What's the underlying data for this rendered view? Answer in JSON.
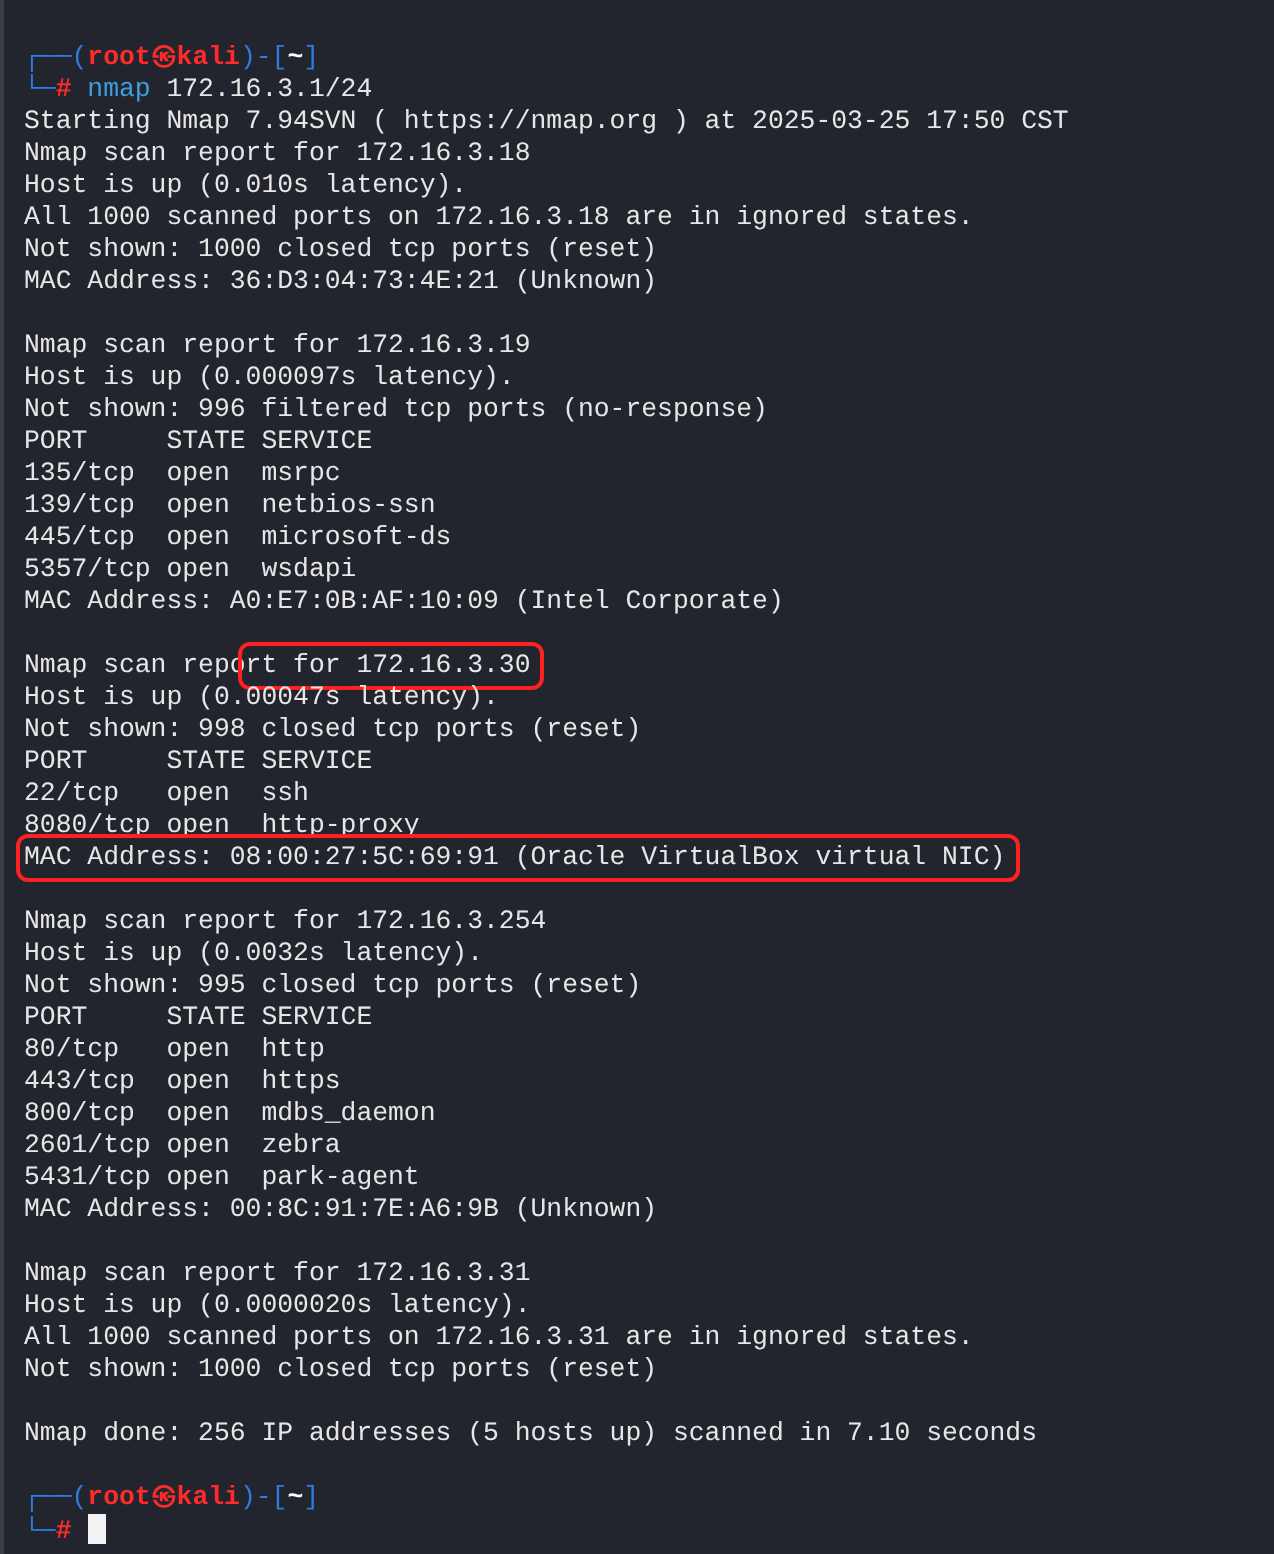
{
  "terminal": {
    "lines": [
      {
        "kind": "prompt",
        "segments": [
          {
            "text": "┌──(",
            "kind": "frame"
          },
          {
            "text": "root㉿kali",
            "kind": "user"
          },
          {
            "text": ")-[",
            "kind": "frame"
          },
          {
            "text": "~",
            "kind": "path"
          },
          {
            "text": "]",
            "kind": "frame"
          }
        ]
      },
      {
        "kind": "command",
        "segments": [
          {
            "text": "└─",
            "kind": "frame"
          },
          {
            "text": "#",
            "kind": "hash"
          },
          {
            "text": "nmap",
            "kind": "program"
          },
          {
            "text": " 172.16.3.1/24",
            "kind": "plain"
          }
        ]
      },
      {
        "kind": "output",
        "segments": [
          {
            "text": "Starting Nmap 7.94SVN ( https://nmap.org ) at 2025-03-25 17:50 CST",
            "highlighted": false
          }
        ]
      },
      {
        "kind": "output",
        "segments": [
          {
            "text": "Nmap scan report for 172.16.3.18",
            "highlighted": false
          }
        ]
      },
      {
        "kind": "output",
        "segments": [
          {
            "text": "Host is up (0.010s latency).",
            "highlighted": false
          }
        ]
      },
      {
        "kind": "output",
        "segments": [
          {
            "text": "All 1000 scanned ports on 172.16.3.18 are in ignored states.",
            "highlighted": false
          }
        ]
      },
      {
        "kind": "output",
        "segments": [
          {
            "text": "Not shown: 1000 closed tcp ports (reset)",
            "highlighted": false
          }
        ]
      },
      {
        "kind": "output",
        "segments": [
          {
            "text": "MAC Address: 36:D3:04:73:4E:21 (Unknown)",
            "highlighted": false
          }
        ]
      },
      {
        "kind": "blank"
      },
      {
        "kind": "output",
        "segments": [
          {
            "text": "Nmap scan report for 172.16.3.19",
            "highlighted": false
          }
        ]
      },
      {
        "kind": "output",
        "segments": [
          {
            "text": "Host is up (0.000097s latency).",
            "highlighted": false
          }
        ]
      },
      {
        "kind": "output",
        "segments": [
          {
            "text": "Not shown: 996 filtered tcp ports (no-response)",
            "highlighted": false
          }
        ]
      },
      {
        "kind": "output",
        "segments": [
          {
            "text": "PORT     STATE SERVICE",
            "highlighted": false
          }
        ]
      },
      {
        "kind": "output",
        "segments": [
          {
            "text": "135/tcp  open  msrpc",
            "highlighted": false
          }
        ]
      },
      {
        "kind": "output",
        "segments": [
          {
            "text": "139/tcp  open  netbios-ssn",
            "highlighted": false
          }
        ]
      },
      {
        "kind": "output",
        "segments": [
          {
            "text": "445/tcp  open  microsoft-ds",
            "highlighted": false
          }
        ]
      },
      {
        "kind": "output",
        "segments": [
          {
            "text": "5357/tcp open  wsdapi",
            "highlighted": false
          }
        ]
      },
      {
        "kind": "output",
        "segments": [
          {
            "text": "MAC Address: A0:E7:0B:AF:10:09 (Intel Corporate)",
            "highlighted": false
          }
        ]
      },
      {
        "kind": "blank"
      },
      {
        "kind": "output",
        "segments": [
          {
            "text": "Nmap scan repo",
            "highlighted": false
          },
          {
            "text": "rt for 172.16.3.30",
            "highlighted": true
          }
        ]
      },
      {
        "kind": "output",
        "segments": [
          {
            "text": "Host is up (0.00047s latency).",
            "highlighted": false
          }
        ]
      },
      {
        "kind": "output",
        "segments": [
          {
            "text": "Not shown: 998 closed tcp ports (reset)",
            "highlighted": false
          }
        ]
      },
      {
        "kind": "output",
        "segments": [
          {
            "text": "PORT     STATE SERVICE",
            "highlighted": false
          }
        ]
      },
      {
        "kind": "output",
        "segments": [
          {
            "text": "22/tcp   open  ssh",
            "highlighted": false
          }
        ]
      },
      {
        "kind": "output",
        "segments": [
          {
            "text": "8080/tcp open  http-proxy",
            "highlighted": false
          }
        ]
      },
      {
        "kind": "output",
        "segments": [
          {
            "text": "MAC Address: 08:00:27:5C:69:91 (Oracle VirtualBox virtual NIC)",
            "highlighted": true
          }
        ]
      },
      {
        "kind": "blank"
      },
      {
        "kind": "output",
        "segments": [
          {
            "text": "Nmap scan report for 172.16.3.254",
            "highlighted": false
          }
        ]
      },
      {
        "kind": "output",
        "segments": [
          {
            "text": "Host is up (0.0032s latency).",
            "highlighted": false
          }
        ]
      },
      {
        "kind": "output",
        "segments": [
          {
            "text": "Not shown: 995 closed tcp ports (reset)",
            "highlighted": false
          }
        ]
      },
      {
        "kind": "output",
        "segments": [
          {
            "text": "PORT     STATE SERVICE",
            "highlighted": false
          }
        ]
      },
      {
        "kind": "output",
        "segments": [
          {
            "text": "80/tcp   open  http",
            "highlighted": false
          }
        ]
      },
      {
        "kind": "output",
        "segments": [
          {
            "text": "443/tcp  open  https",
            "highlighted": false
          }
        ]
      },
      {
        "kind": "output",
        "segments": [
          {
            "text": "800/tcp  open  mdbs_daemon",
            "highlighted": false
          }
        ]
      },
      {
        "kind": "output",
        "segments": [
          {
            "text": "2601/tcp open  zebra",
            "highlighted": false
          }
        ]
      },
      {
        "kind": "output",
        "segments": [
          {
            "text": "5431/tcp open  park-agent",
            "highlighted": false
          }
        ]
      },
      {
        "kind": "output",
        "segments": [
          {
            "text": "MAC Address: 00:8C:91:7E:A6:9B (Unknown)",
            "highlighted": false
          }
        ]
      },
      {
        "kind": "blank"
      },
      {
        "kind": "output",
        "segments": [
          {
            "text": "Nmap scan report for 172.16.3.31",
            "highlighted": false
          }
        ]
      },
      {
        "kind": "output",
        "segments": [
          {
            "text": "Host is up (0.0000020s latency).",
            "highlighted": false
          }
        ]
      },
      {
        "kind": "output",
        "segments": [
          {
            "text": "All 1000 scanned ports on 172.16.3.31 are in ignored states.",
            "highlighted": false
          }
        ]
      },
      {
        "kind": "output",
        "segments": [
          {
            "text": "Not shown: 1000 closed tcp ports (reset)",
            "highlighted": false
          }
        ]
      },
      {
        "kind": "blank"
      },
      {
        "kind": "output",
        "segments": [
          {
            "text": "Nmap done: 256 IP addresses (5 hosts up) scanned in 7.10 seconds",
            "highlighted": false
          }
        ]
      },
      {
        "kind": "blank"
      },
      {
        "kind": "prompt",
        "segments": [
          {
            "text": "┌──(",
            "kind": "frame"
          },
          {
            "text": "root㉿kali",
            "kind": "user"
          },
          {
            "text": ")-[",
            "kind": "frame"
          },
          {
            "text": "~",
            "kind": "path"
          },
          {
            "text": "]",
            "kind": "frame"
          }
        ]
      },
      {
        "kind": "command",
        "cursor": true,
        "segments": [
          {
            "text": "└─",
            "kind": "frame"
          },
          {
            "text": "#",
            "kind": "hash"
          }
        ]
      }
    ]
  }
}
